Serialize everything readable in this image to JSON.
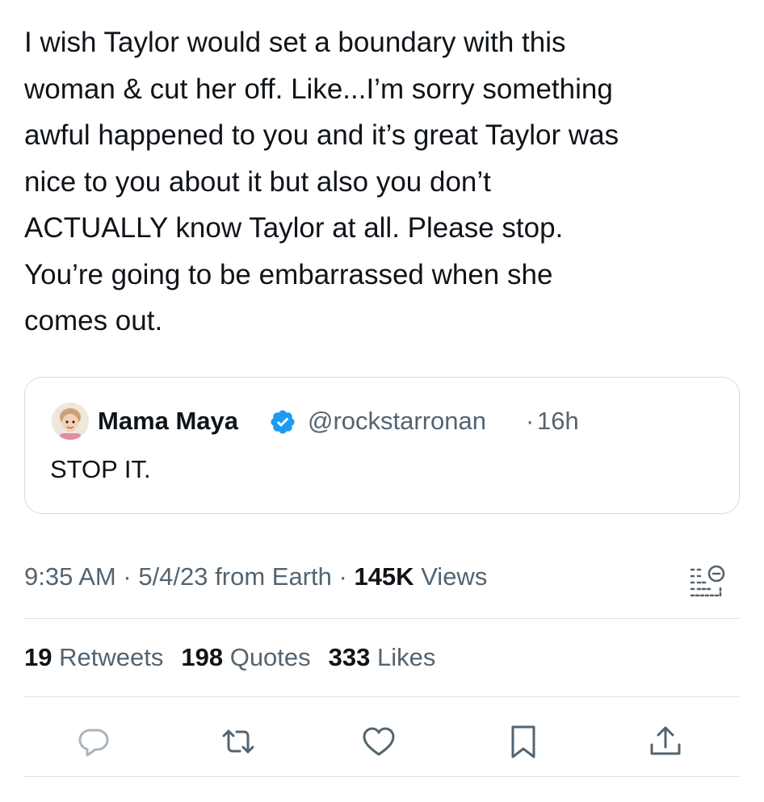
{
  "tweet": {
    "text": "I wish Taylor would set a boundary with this\nwoman & cut her off. Like...I’m sorry something\nawful happened to you and it’s great Taylor was\nnice to you about it but also you don’t\nACTUALLY know Taylor at all. Please stop.\nYou’re going to be embarrassed when she\ncomes out."
  },
  "quoted": {
    "name": "Mama Maya",
    "handle": "@rockstarronan",
    "separator": "·",
    "time": "16h",
    "text": "STOP IT."
  },
  "meta": {
    "time": "9:35 AM",
    "dot1": "·",
    "date": "5/4/23",
    "source": "from Earth",
    "dot2": "·",
    "views_count": "145K",
    "views_label": "Views"
  },
  "stats": {
    "retweets_count": "19",
    "retweets_label": "Retweets",
    "quotes_count": "198",
    "quotes_label": "Quotes",
    "likes_count": "333",
    "likes_label": "Likes"
  },
  "icons": {
    "reply": "reply-icon",
    "retweet": "retweet-icon",
    "like": "heart-icon",
    "bookmark": "bookmark-icon",
    "share": "share-icon",
    "analytics": "analytics-icon",
    "verified": "verified-badge-icon"
  },
  "colors": {
    "text": "#0f1419",
    "secondary": "#536471",
    "verified": "#1d9bf0",
    "border": "#d7dce0"
  }
}
